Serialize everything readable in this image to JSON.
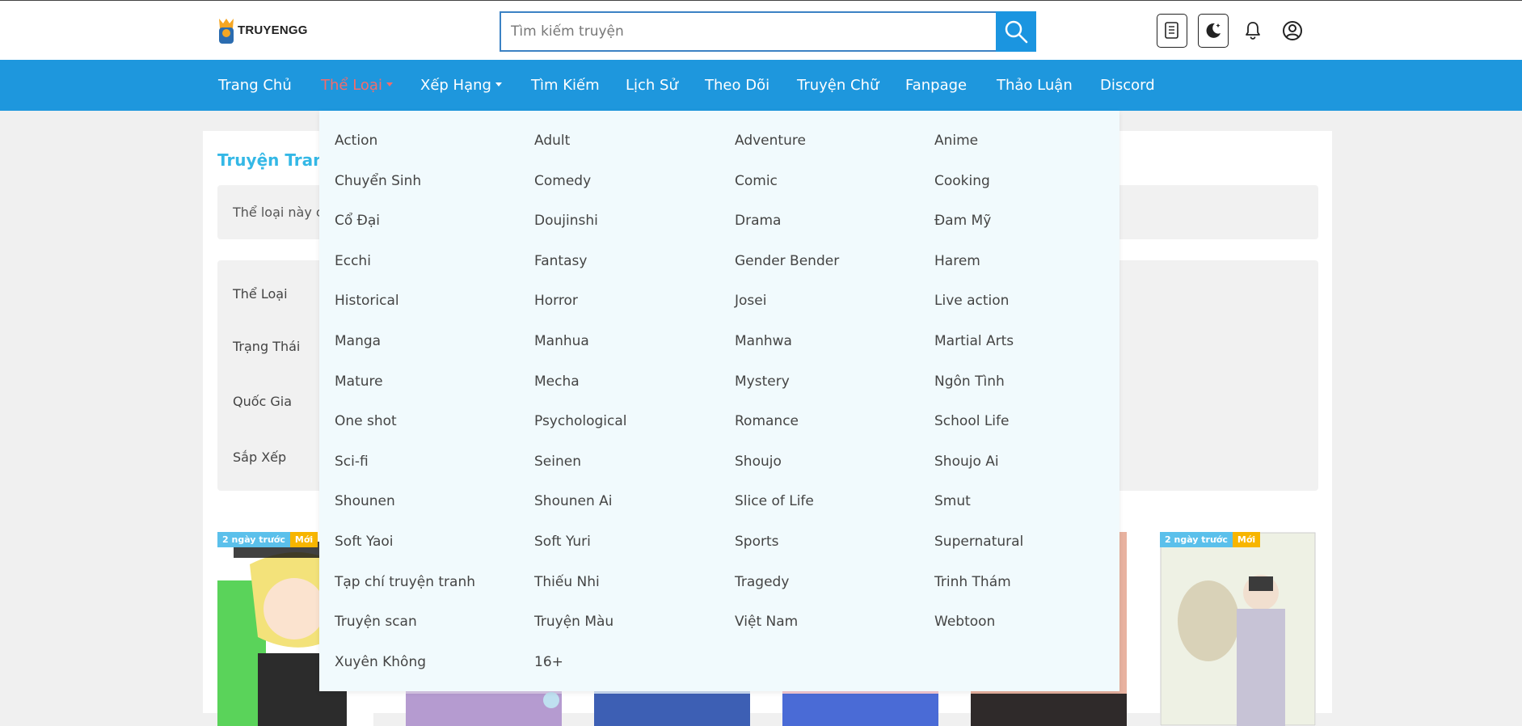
{
  "header": {
    "logo_text": "TRUYENGG",
    "search": {
      "placeholder": "Tìm kiếm truyện",
      "value": ""
    },
    "icons": [
      "reading-list-icon",
      "dark-mode-icon",
      "bell-icon",
      "user-icon"
    ]
  },
  "nav": {
    "items": [
      {
        "label": "Trang Chủ",
        "active": false,
        "caret": false
      },
      {
        "label": "Thể Loại",
        "active": true,
        "caret": true
      },
      {
        "label": "Xếp Hạng",
        "active": false,
        "caret": true
      },
      {
        "label": "Tìm Kiếm",
        "active": false,
        "caret": false
      },
      {
        "label": "Lịch Sử",
        "active": false,
        "caret": false
      },
      {
        "label": "Theo Dõi",
        "active": false,
        "caret": false
      },
      {
        "label": "Truyện Chữ",
        "active": false,
        "caret": false
      },
      {
        "label": "Fanpage",
        "active": false,
        "caret": false
      },
      {
        "label": "Thảo Luận",
        "active": false,
        "caret": false
      },
      {
        "label": "Discord",
        "active": false,
        "caret": false
      }
    ]
  },
  "main": {
    "title": "Truyện Tranh",
    "info_text": "Thể loại này c",
    "filters": [
      "Thể Loại",
      "Trạng Thái",
      "Quốc Gia",
      "Sắp Xếp"
    ],
    "cards": [
      {
        "time": "2 ngày trước",
        "badge": "Mới"
      },
      {
        "time": "",
        "badge": ""
      },
      {
        "time": "",
        "badge": ""
      },
      {
        "time": "",
        "badge": ""
      },
      {
        "time": "",
        "badge": ""
      },
      {
        "time": "2 ngày trước",
        "badge": "Mới"
      }
    ]
  },
  "genres": [
    "Action",
    "Adult",
    "Adventure",
    "Anime",
    "Chuyển Sinh",
    "Comedy",
    "Comic",
    "Cooking",
    "Cổ Đại",
    "Doujinshi",
    "Drama",
    "Đam Mỹ",
    "Ecchi",
    "Fantasy",
    "Gender Bender",
    "Harem",
    "Historical",
    "Horror",
    "Josei",
    "Live action",
    "Manga",
    "Manhua",
    "Manhwa",
    "Martial Arts",
    "Mature",
    "Mecha",
    "Mystery",
    "Ngôn Tình",
    "One shot",
    "Psychological",
    "Romance",
    "School Life",
    "Sci-fi",
    "Seinen",
    "Shoujo",
    "Shoujo Ai",
    "Shounen",
    "Shounen Ai",
    "Slice of Life",
    "Smut",
    "Soft Yaoi",
    "Soft Yuri",
    "Sports",
    "Supernatural",
    "Tạp chí truyện tranh",
    "Thiếu Nhi",
    "Tragedy",
    "Trinh Thám",
    "Truyện scan",
    "Truyện Màu",
    "Việt Nam",
    "Webtoon",
    "Xuyên Không",
    "16+"
  ],
  "colors": {
    "navbar": "#1e97dd",
    "active_nav": "#f56b6b",
    "title": "#34b8e6",
    "dropdown_bg": "#f1fafd"
  }
}
